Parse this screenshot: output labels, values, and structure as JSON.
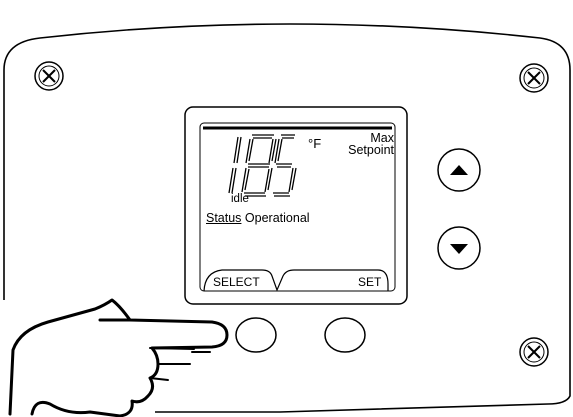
{
  "display": {
    "reading": "185",
    "unit": "°F",
    "mode_line1": "Max",
    "mode_line2": "Setpoint",
    "state": "idle",
    "status_label": "Status",
    "status_value": "Operational",
    "softkey_left": "SELECT",
    "softkey_right": "SET"
  },
  "controls": {
    "up_icon": "triangle-up",
    "down_icon": "triangle-down"
  },
  "colors": {
    "ink": "#000000",
    "background": "#ffffff"
  }
}
